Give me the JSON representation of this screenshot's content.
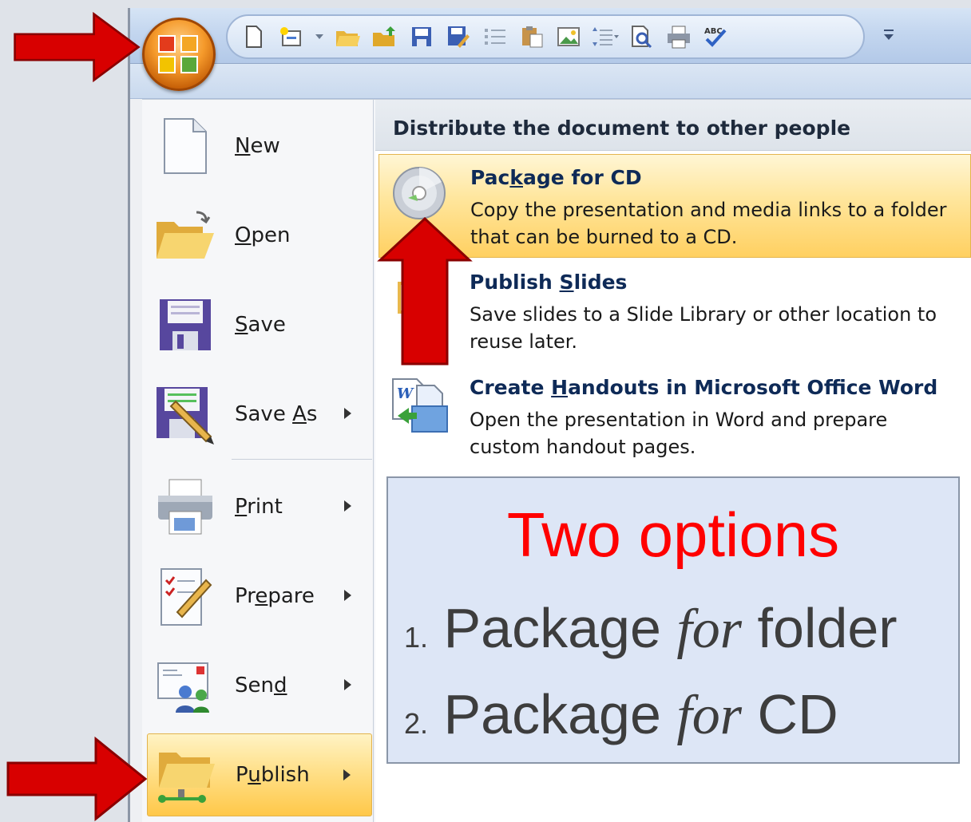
{
  "qat": {
    "icons": [
      "new-doc-icon",
      "new-slide-icon",
      "open-folder-icon",
      "folder-up-icon",
      "save-icon",
      "save-as-icon",
      "bullets-icon",
      "paste-icon",
      "picture-icon",
      "line-spacing-icon",
      "print-preview-icon",
      "print-icon",
      "spelling-icon"
    ],
    "dropdown": "↧"
  },
  "menu": {
    "items": [
      {
        "label": "New",
        "mnemonic_pre": "",
        "mnemonic": "N",
        "mnemonic_post": "ew",
        "has_submenu": false
      },
      {
        "label": "Open",
        "mnemonic_pre": "",
        "mnemonic": "O",
        "mnemonic_post": "pen",
        "has_submenu": false
      },
      {
        "label": "Save",
        "mnemonic_pre": "",
        "mnemonic": "S",
        "mnemonic_post": "ave",
        "has_submenu": false
      },
      {
        "label": "Save As",
        "mnemonic_pre": "Save ",
        "mnemonic": "A",
        "mnemonic_post": "s",
        "has_submenu": true
      },
      {
        "label": "Print",
        "mnemonic_pre": "",
        "mnemonic": "P",
        "mnemonic_post": "rint",
        "has_submenu": true
      },
      {
        "label": "Prepare",
        "mnemonic_pre": "Pr",
        "mnemonic": "e",
        "mnemonic_post": "pare",
        "has_submenu": true
      },
      {
        "label": "Send",
        "mnemonic_pre": "Sen",
        "mnemonic": "d",
        "mnemonic_post": "",
        "has_submenu": true
      },
      {
        "label": "Publish",
        "mnemonic_pre": "P",
        "mnemonic": "u",
        "mnemonic_post": "blish",
        "has_submenu": true
      }
    ]
  },
  "publish": {
    "header": "Distribute the document to other people",
    "items": [
      {
        "title_pre": "Pac",
        "title_mn": "k",
        "title_post": "age for CD",
        "desc": "Copy the presentation and media links to a folder that can be burned to a CD."
      },
      {
        "title_pre": "Publish ",
        "title_mn": "S",
        "title_post": "lides",
        "desc": "Save slides to a Slide Library or other location to reuse later."
      },
      {
        "title_pre": "Create ",
        "title_mn": "H",
        "title_post": "andouts in Microsoft Office Word",
        "desc": "Open the presentation in Word and prepare custom handout pages."
      }
    ]
  },
  "callout": {
    "title": "Two options",
    "items": [
      {
        "num": "1.",
        "pre": "Package ",
        "italic": "for",
        "post": " folder"
      },
      {
        "num": "2.",
        "pre": "Package ",
        "italic": "for",
        "post": " CD"
      }
    ]
  },
  "colors": {
    "arrow": "#d80000",
    "highlight": "#ffd061",
    "callout_title": "#ff0000"
  }
}
